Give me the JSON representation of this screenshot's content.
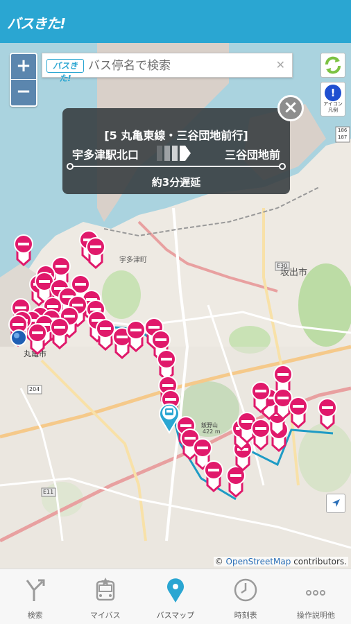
{
  "app": {
    "logo_text": "バスきた!"
  },
  "search": {
    "placeholder": "バス停名で検索",
    "logo_text": "バスきた!"
  },
  "zoom": {
    "in_label": "+",
    "out_label": "−"
  },
  "legend": {
    "icon_label": "!",
    "label_line1": "アイコン",
    "label_line2": "凡例"
  },
  "popup": {
    "route": "[5 丸亀東線・三谷団地前行]",
    "from": "宇多津駅北口",
    "to": "三谷団地前",
    "status": "約3分遅延"
  },
  "map": {
    "place_labels": [
      "宇多津町",
      "坂出市",
      "丸亀市",
      "飯野山",
      "422 m"
    ],
    "road_labels": [
      "E30",
      "E11",
      "E11",
      "204",
      "186",
      "187",
      "186"
    ]
  },
  "attribution": {
    "prefix": "©",
    "link": "OpenStreetMap",
    "suffix": "contributors."
  },
  "nav": {
    "items": [
      {
        "label": "検索"
      },
      {
        "label": "マイバス"
      },
      {
        "label": "バスマップ"
      },
      {
        "label": "時刻表"
      },
      {
        "label": "操作説明他"
      }
    ]
  },
  "colors": {
    "header": "#2aa6d2",
    "stop_marker": "#e0196b",
    "route_line": "#1e9bc5",
    "popup_bg": "#343a3e"
  }
}
